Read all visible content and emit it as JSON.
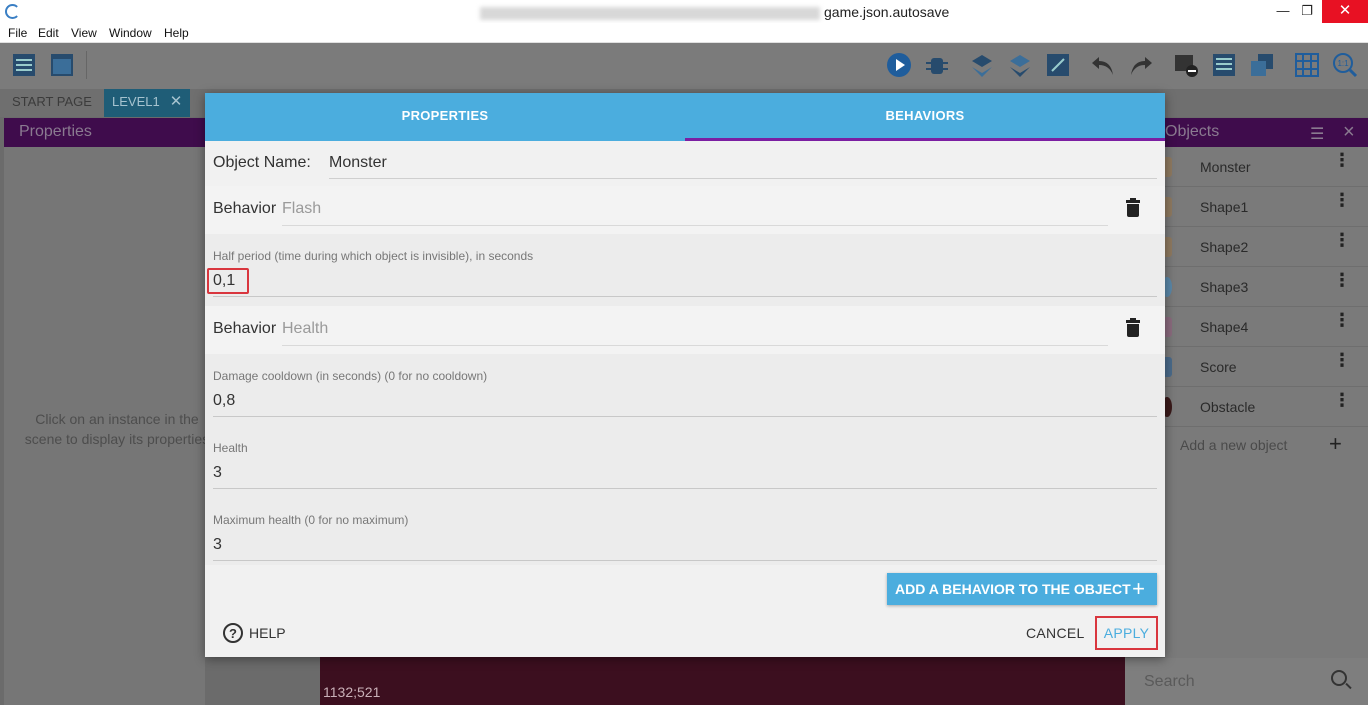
{
  "window": {
    "title_suffix": "game.json.autosave",
    "minimize": "—",
    "maximize": "❐",
    "close": "✕"
  },
  "menu": [
    "File",
    "Edit",
    "View",
    "Window",
    "Help"
  ],
  "tabs": {
    "start_page": "START PAGE",
    "level1": "LEVEL1",
    "close": "✕"
  },
  "left_panel": {
    "title": "Properties",
    "hint": "Click on an instance in the scene to display its properties"
  },
  "right_panel": {
    "title": "Objects",
    "objects": [
      "Monster",
      "Shape1",
      "Shape2",
      "Shape3",
      "Shape4",
      "Score",
      "Obstacle"
    ],
    "add_new": "Add a new object",
    "search_placeholder": "Search"
  },
  "scene": {
    "coords": "1132;521"
  },
  "dialog": {
    "tab_properties": "PROPERTIES",
    "tab_behaviors": "BEHAVIORS",
    "object_name_label": "Object Name:",
    "object_name_value": "Monster",
    "behaviors": [
      {
        "label": "Behavior",
        "name": "Flash",
        "fields": [
          {
            "label": "Half period (time during which object is invisible), in seconds",
            "value": "0,1"
          }
        ]
      },
      {
        "label": "Behavior",
        "name": "Health",
        "fields": [
          {
            "label": "Damage cooldown (in seconds) (0 for no cooldown)",
            "value": "0,8"
          },
          {
            "label": "Health",
            "value": "3"
          },
          {
            "label": "Maximum health (0 for no maximum)",
            "value": "3"
          }
        ]
      }
    ],
    "add_behavior": "ADD A BEHAVIOR TO THE OBJECT",
    "add_behavior_icon": "plus-icon",
    "help": "HELP",
    "cancel": "CANCEL",
    "apply": "APPLY"
  },
  "colors": {
    "accent_blue": "#4badde",
    "tab_indicator": "#7b1fa2",
    "highlight_red": "#d9363e",
    "panel_header": "#3f0c4c"
  }
}
